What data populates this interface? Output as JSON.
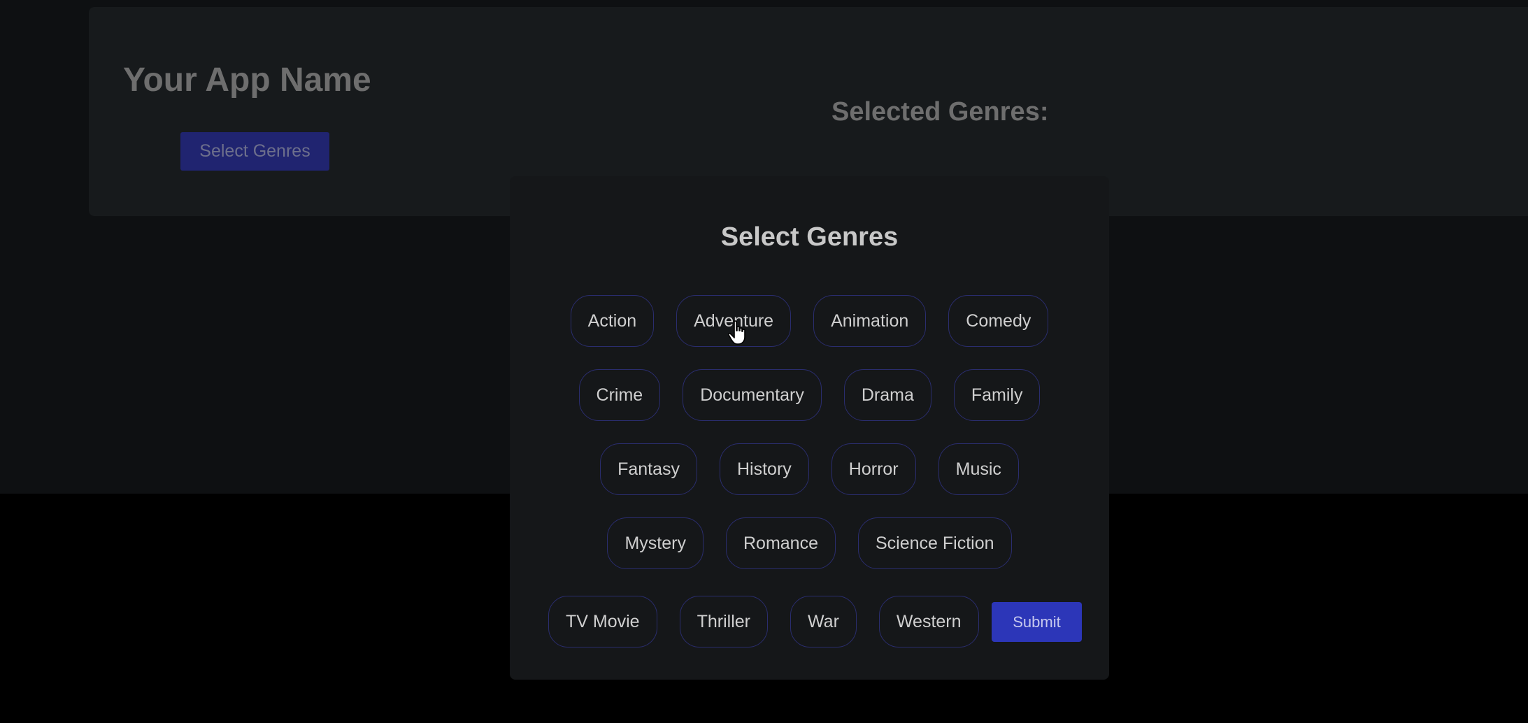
{
  "header": {
    "app_name": "Your App Name",
    "select_button_label": "Select Genres",
    "selected_heading": "Selected Genres:"
  },
  "modal": {
    "title": "Select Genres",
    "genres": [
      "Action",
      "Adventure",
      "Animation",
      "Comedy",
      "Crime",
      "Documentary",
      "Drama",
      "Family",
      "Fantasy",
      "History",
      "Horror",
      "Music",
      "Mystery",
      "Romance",
      "Science Fiction",
      "TV Movie",
      "Thriller",
      "War",
      "Western"
    ],
    "submit_label": "Submit"
  },
  "colors": {
    "accent": "#2c36b8",
    "chip_border": "#2a2d6e",
    "modal_background": "#151719"
  },
  "icons": {
    "cursor": "hand-pointer-cursor-icon"
  }
}
